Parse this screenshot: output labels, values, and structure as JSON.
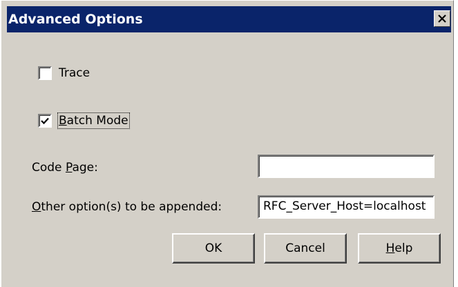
{
  "window": {
    "title": "Advanced Options",
    "close_icon": "close-icon"
  },
  "options": {
    "trace": {
      "label": "Trace",
      "checked": false
    },
    "batch_mode": {
      "label_prefix": "B",
      "label_rest": "atch Mode",
      "checked": true
    }
  },
  "fields": {
    "code_page": {
      "label_prefix": "Code ",
      "label_mnemonic": "P",
      "label_rest": "age:",
      "value": ""
    },
    "other_options": {
      "label_mnemonic": "O",
      "label_rest": "ther option(s) to be appended:",
      "value": "RFC_Server_Host=localhost"
    }
  },
  "buttons": {
    "ok_label": "OK",
    "cancel_label": "Cancel",
    "help_mnemonic": "H",
    "help_rest": "elp"
  },
  "colors": {
    "titlebar": "#0a246a",
    "dialog_face": "#d4d0c8"
  }
}
